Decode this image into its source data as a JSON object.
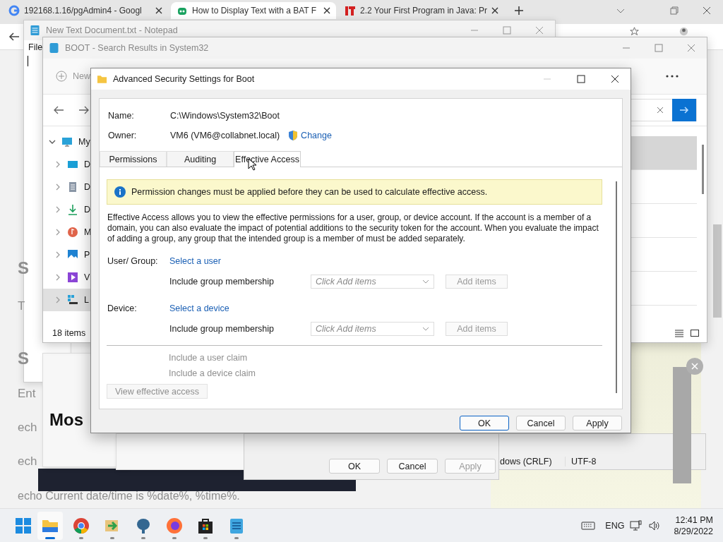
{
  "browser": {
    "tabs": [
      {
        "title": "192168.1.16/pgAdmin4 - Googl",
        "selected": false
      },
      {
        "title": "How to Display Text with a BAT F",
        "selected": true
      },
      {
        "title": "2.2 Your First Program in Java: Pr",
        "selected": false
      }
    ]
  },
  "page": {
    "fragments": [
      "S",
      "T",
      "S",
      "Ent",
      "ech",
      "ech"
    ],
    "heading": "Mos",
    "code_line": "echo Current date/time is %date%, %time%."
  },
  "notepad": {
    "title": "New Text Document.txt - Notepad",
    "menu": "File",
    "status": [
      "dows (CRLF)",
      "UTF-8"
    ]
  },
  "explorer": {
    "title": "BOOT - Search Results in System32",
    "new_label": "New",
    "tree": [
      {
        "label": "My",
        "expanded": true,
        "selected": false,
        "children": [
          {
            "label": "D",
            "expanded": false,
            "selected": false
          },
          {
            "label": "D",
            "expanded": false,
            "selected": false
          },
          {
            "label": "D",
            "expanded": false,
            "selected": false
          },
          {
            "label": "M",
            "expanded": false,
            "selected": false
          },
          {
            "label": "P",
            "expanded": false,
            "selected": false
          },
          {
            "label": "V",
            "expanded": false,
            "selected": false
          },
          {
            "label": "L",
            "expanded": false,
            "selected": true
          }
        ]
      }
    ],
    "results": [
      {
        "selected": true
      },
      {
        "selected": false
      },
      {
        "selected": false
      },
      {
        "selected": false
      },
      {
        "selected": false
      }
    ],
    "status": "18 items"
  },
  "dialog": {
    "title": "Advanced Security Settings for Boot",
    "name_label": "Name:",
    "name": "C:\\Windows\\System32\\Boot",
    "owner_label": "Owner:",
    "owner": "VM6 (VM6@collabnet.local)",
    "change_link": "Change",
    "tabs": [
      {
        "label": "Permissions",
        "selected": false
      },
      {
        "label": "Auditing",
        "selected": false
      },
      {
        "label": "Effective Access",
        "selected": true
      }
    ],
    "banner": "Permission changes must be applied before they can be used to calculate effective access.",
    "description": "Effective Access allows you to view the effective permissions for a user, group, or device account. If the account is a member of a domain, you can also evaluate the impact of potential additions to the security token for the account. When you evaluate the impact of adding a group, any group that the intended group is a member of must be added separately.",
    "principals": [
      {
        "label": "User/ Group:",
        "link": "Select a user",
        "membership_label": "Include group membership",
        "dropdown": {
          "placeholder": "Click Add items",
          "disabled": true
        },
        "add_button": {
          "label": "Add items",
          "disabled": true
        }
      },
      {
        "label": "Device:",
        "link": "Select a device",
        "membership_label": "Include group membership",
        "dropdown": {
          "placeholder": "Click Add items",
          "disabled": true
        },
        "add_button": {
          "label": "Add items",
          "disabled": true
        }
      }
    ],
    "claims": [
      {
        "label": "Include a user claim",
        "disabled": true
      },
      {
        "label": "Include a device claim",
        "disabled": true
      }
    ],
    "view_button": {
      "label": "View effective access",
      "disabled": true
    },
    "buttons": [
      {
        "label": "OK",
        "default": true
      },
      {
        "label": "Cancel",
        "default": false
      },
      {
        "label": "Apply",
        "default": false
      }
    ]
  },
  "back_dialog": {
    "buttons": [
      {
        "label": "OK",
        "disabled": false
      },
      {
        "label": "Cancel",
        "disabled": false
      },
      {
        "label": "Apply",
        "disabled": true
      }
    ]
  },
  "taskbar": {
    "apps": [
      {
        "active": true
      },
      {
        "active": false
      },
      {
        "active": false
      },
      {
        "active": false
      },
      {
        "active": false
      },
      {
        "active": false
      },
      {
        "active": false
      }
    ],
    "language": "ENG",
    "time": "12:41 PM",
    "date": "8/29/2022"
  }
}
